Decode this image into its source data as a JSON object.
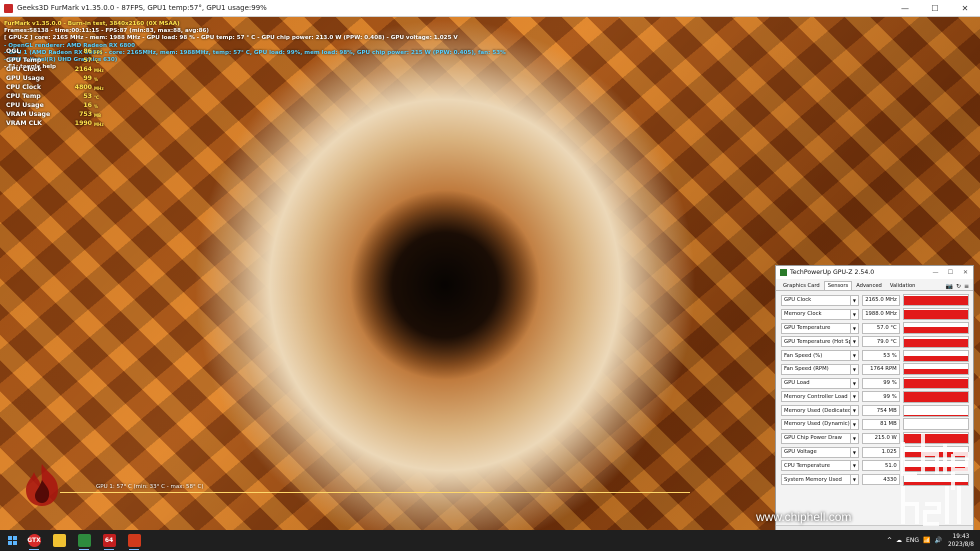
{
  "window": {
    "title": "Geeks3D FurMark v1.35.0.0 - 87FPS, GPU1 temp:57°, GPU1 usage:99%",
    "controls": [
      "—",
      "☐",
      "✕"
    ]
  },
  "osd": {
    "lines": [
      {
        "text": "FurMark v1.35.0.0 - Burn-in test, 3840x2160 (0X MSAA)",
        "color": "yellow"
      },
      {
        "text": "Frames:58138 - time:00:11:15 - FPS:87 (min:83, max:88, avg:86)",
        "color": "white"
      },
      {
        "text": "[ GPU-Z ] core: 2165 MHz - mem: 1988 MHz - GPU load: 98 % - GPU temp: 57 ° C - GPU chip power: 213.0 W (PPW: 0.408) - GPU voltage: 1.025 V",
        "color": "white"
      },
      {
        "text": "- OpenGL renderer: AMD Radeon RX 6800",
        "color": "cyan"
      },
      {
        "text": "- GPU 1 (AMD Radeon RX 6800) - core: 2165MHz, mem: 1988MHz, temp: 57° C, GPU load: 99%, mem load: 98%, GPU chip power: 215 W (PPW: 0.405), fan: 53%",
        "color": "cyan"
      },
      {
        "text": "- GPU 2 (Intel(R) UHD Graphics 630)",
        "color": "cyan"
      },
      {
        "text": "- F1: toggle help",
        "color": "white"
      }
    ],
    "monitor": [
      {
        "label": "OGL",
        "value": "86",
        "unit": "FPS"
      },
      {
        "label": "GPU Temp",
        "value": "57",
        "unit": "°C"
      },
      {
        "label": "GPU Clock",
        "value": "2164",
        "unit": "MHz"
      },
      {
        "label": "GPU Usage",
        "value": "99",
        "unit": "%"
      },
      {
        "label": "CPU Clock",
        "value": "4800",
        "unit": "MHz"
      },
      {
        "label": "CPU Temp",
        "value": "53",
        "unit": "°C"
      },
      {
        "label": "CPU Usage",
        "value": "16",
        "unit": "%"
      },
      {
        "label": "VRAM Usage",
        "value": "753",
        "unit": "MB"
      },
      {
        "label": "VRAM CLK",
        "value": "1990",
        "unit": "MHz"
      }
    ],
    "graph_label": "GPU 1: 57° C (min: 33° C - max: 58° C)"
  },
  "gpuz": {
    "title": "TechPowerUp GPU-Z 2.54.0",
    "tabs": [
      "Graphics Card",
      "Sensors",
      "Advanced",
      "Validation"
    ],
    "active_tab": "Sensors",
    "sensors": [
      {
        "name": "GPU Clock",
        "value": "2165.0 MHz",
        "level": 0.95
      },
      {
        "name": "Memory Clock",
        "value": "1988.0 MHz",
        "level": 0.95
      },
      {
        "name": "GPU Temperature",
        "value": "57.0 °C",
        "level": 0.6
      },
      {
        "name": "GPU Temperature (Hot Spot)",
        "value": "79.0 °C",
        "level": 0.75
      },
      {
        "name": "Fan Speed (%)",
        "value": "53 %",
        "level": 0.5
      },
      {
        "name": "Fan Speed (RPM)",
        "value": "1764 RPM",
        "level": 0.55
      },
      {
        "name": "GPU Load",
        "value": "99 %",
        "level": 0.95
      },
      {
        "name": "Memory Controller Load",
        "value": "99 %",
        "level": 0.95
      },
      {
        "name": "Memory Used (Dedicated)",
        "value": "754 MB",
        "level": 0.05
      },
      {
        "name": "Memory Used (Dynamic)",
        "value": "81 MB",
        "level": 0.0
      },
      {
        "name": "GPU Chip Power Draw",
        "value": "215.0 W",
        "level": 0.95
      },
      {
        "name": "GPU Voltage",
        "value": "1.025",
        "level": 0.5
      },
      {
        "name": "CPU Temperature",
        "value": "51.0",
        "level": 0.4
      },
      {
        "name": "System Memory Used",
        "value": "4330",
        "level": 0.3
      }
    ]
  },
  "watermark": {
    "url": "www.chiphell.com",
    "logo_text": "chip hell"
  },
  "taskbar": {
    "apps": [
      {
        "name": "furmark",
        "label": "GTX",
        "color": "#d62a2a"
      },
      {
        "name": "file-explorer",
        "label": "",
        "color": "#f1c232"
      },
      {
        "name": "gpu-z",
        "label": "",
        "color": "#2e8b3e"
      },
      {
        "name": "aida64",
        "label": "64",
        "color": "#c21f1f"
      },
      {
        "name": "amd-software",
        "label": "",
        "color": "#d03a1c"
      }
    ],
    "tray_icons": [
      "^",
      "☁",
      "ENG",
      "📶",
      "🔊"
    ],
    "time": "19:43",
    "date": "2023/8/8"
  }
}
